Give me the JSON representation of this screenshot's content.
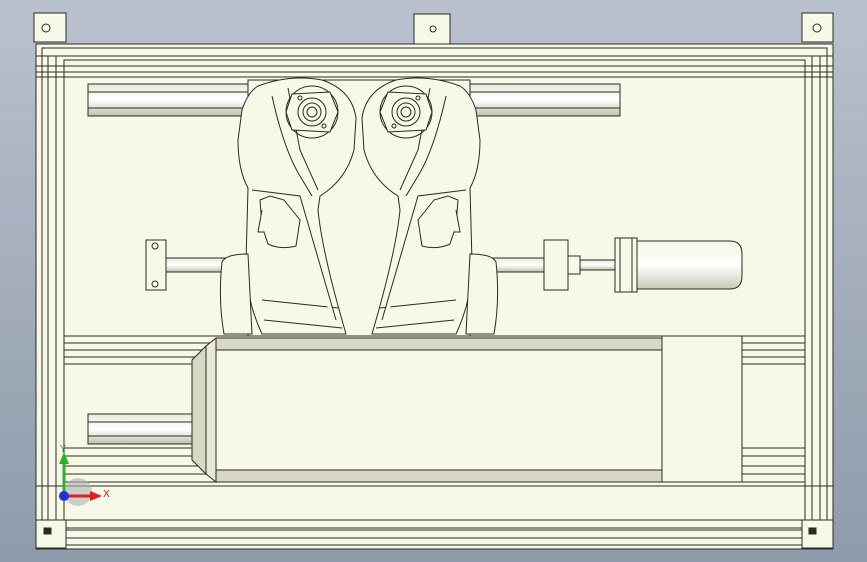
{
  "viewport": {
    "background_top": "#b8c1cd",
    "background_bottom": "#8f9bab"
  },
  "model": {
    "fill_color": "#f8f8e8",
    "edge_color": "#2a2a22",
    "shade_color": "#d8d8c4"
  },
  "triad": {
    "x_label": "X",
    "y_label": "Y",
    "x_color": "#e0201c",
    "y_color": "#28b428",
    "z_color": "#2030e0"
  }
}
